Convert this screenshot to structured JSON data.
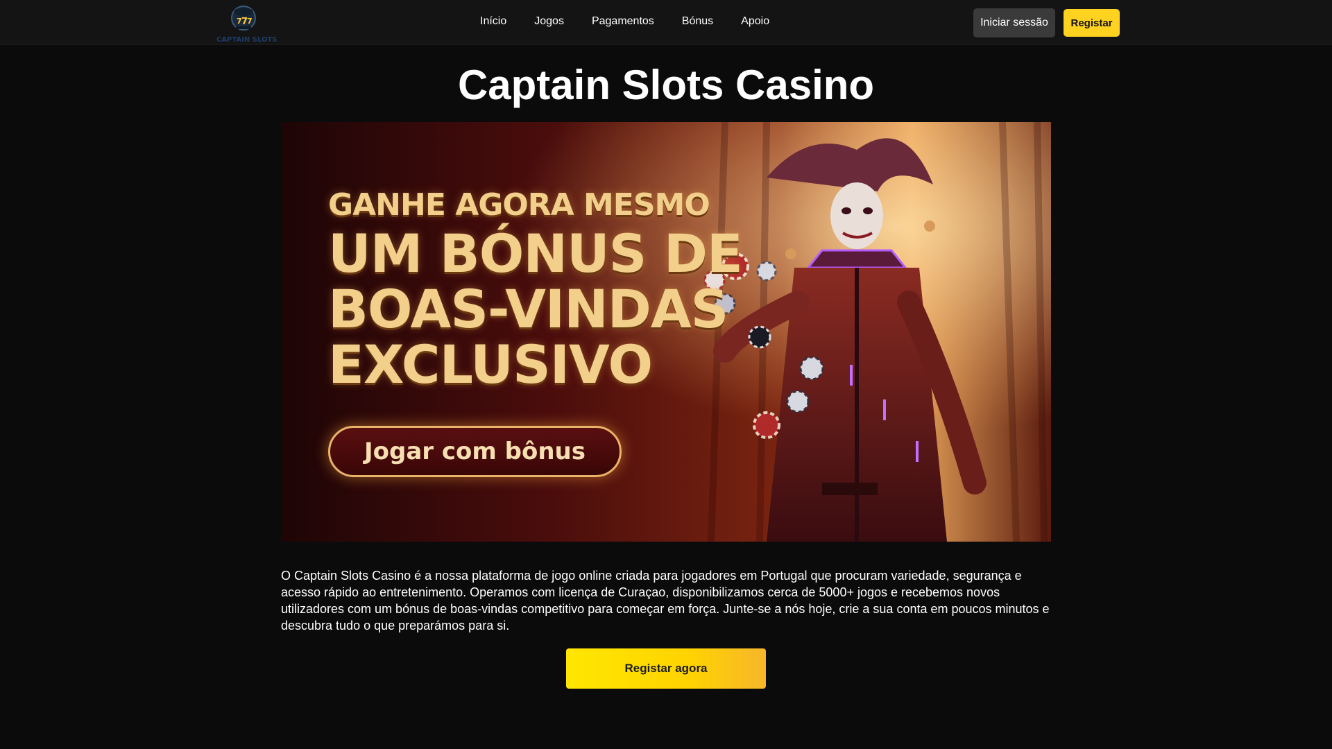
{
  "header": {
    "logo_text": "CAPTAIN SLOTS",
    "nav": [
      {
        "label": "Início"
      },
      {
        "label": "Jogos"
      },
      {
        "label": "Pagamentos"
      },
      {
        "label": "Bónus"
      },
      {
        "label": "Apoio"
      }
    ],
    "login_label": "Iniciar sessão",
    "register_label": "Registar"
  },
  "main": {
    "title": "Captain Slots Casino",
    "banner": {
      "line1": "GANHE AGORA MESMO",
      "line2": "UM BÓNUS DE",
      "line3": "BOAS-VINDAS",
      "line4": "EXCLUSIVO",
      "cta_label": "Jogar com bônus"
    },
    "intro": "O Captain Slots Casino é a nossa plataforma de jogo online criada para jogadores em Portugal que procuram variedade, segurança e acesso rápido ao entretenimento. Operamos com licença de Curaçao, disponibilizamos cerca de 5000+ jogos e recebemos novos utilizadores com um bónus de boas-vindas competitivo para começar em força. Junte-se a nós hoje, crie a sua conta em poucos minutos e descubra tudo o que preparámos para si.",
    "cta_label": "Registar agora"
  },
  "colors": {
    "background": "#0b0b0b",
    "header": "#141414",
    "accent_yellow": "#ffd21f",
    "login_button": "#3a3a3a",
    "banner_gold": "#f2cf8a"
  }
}
